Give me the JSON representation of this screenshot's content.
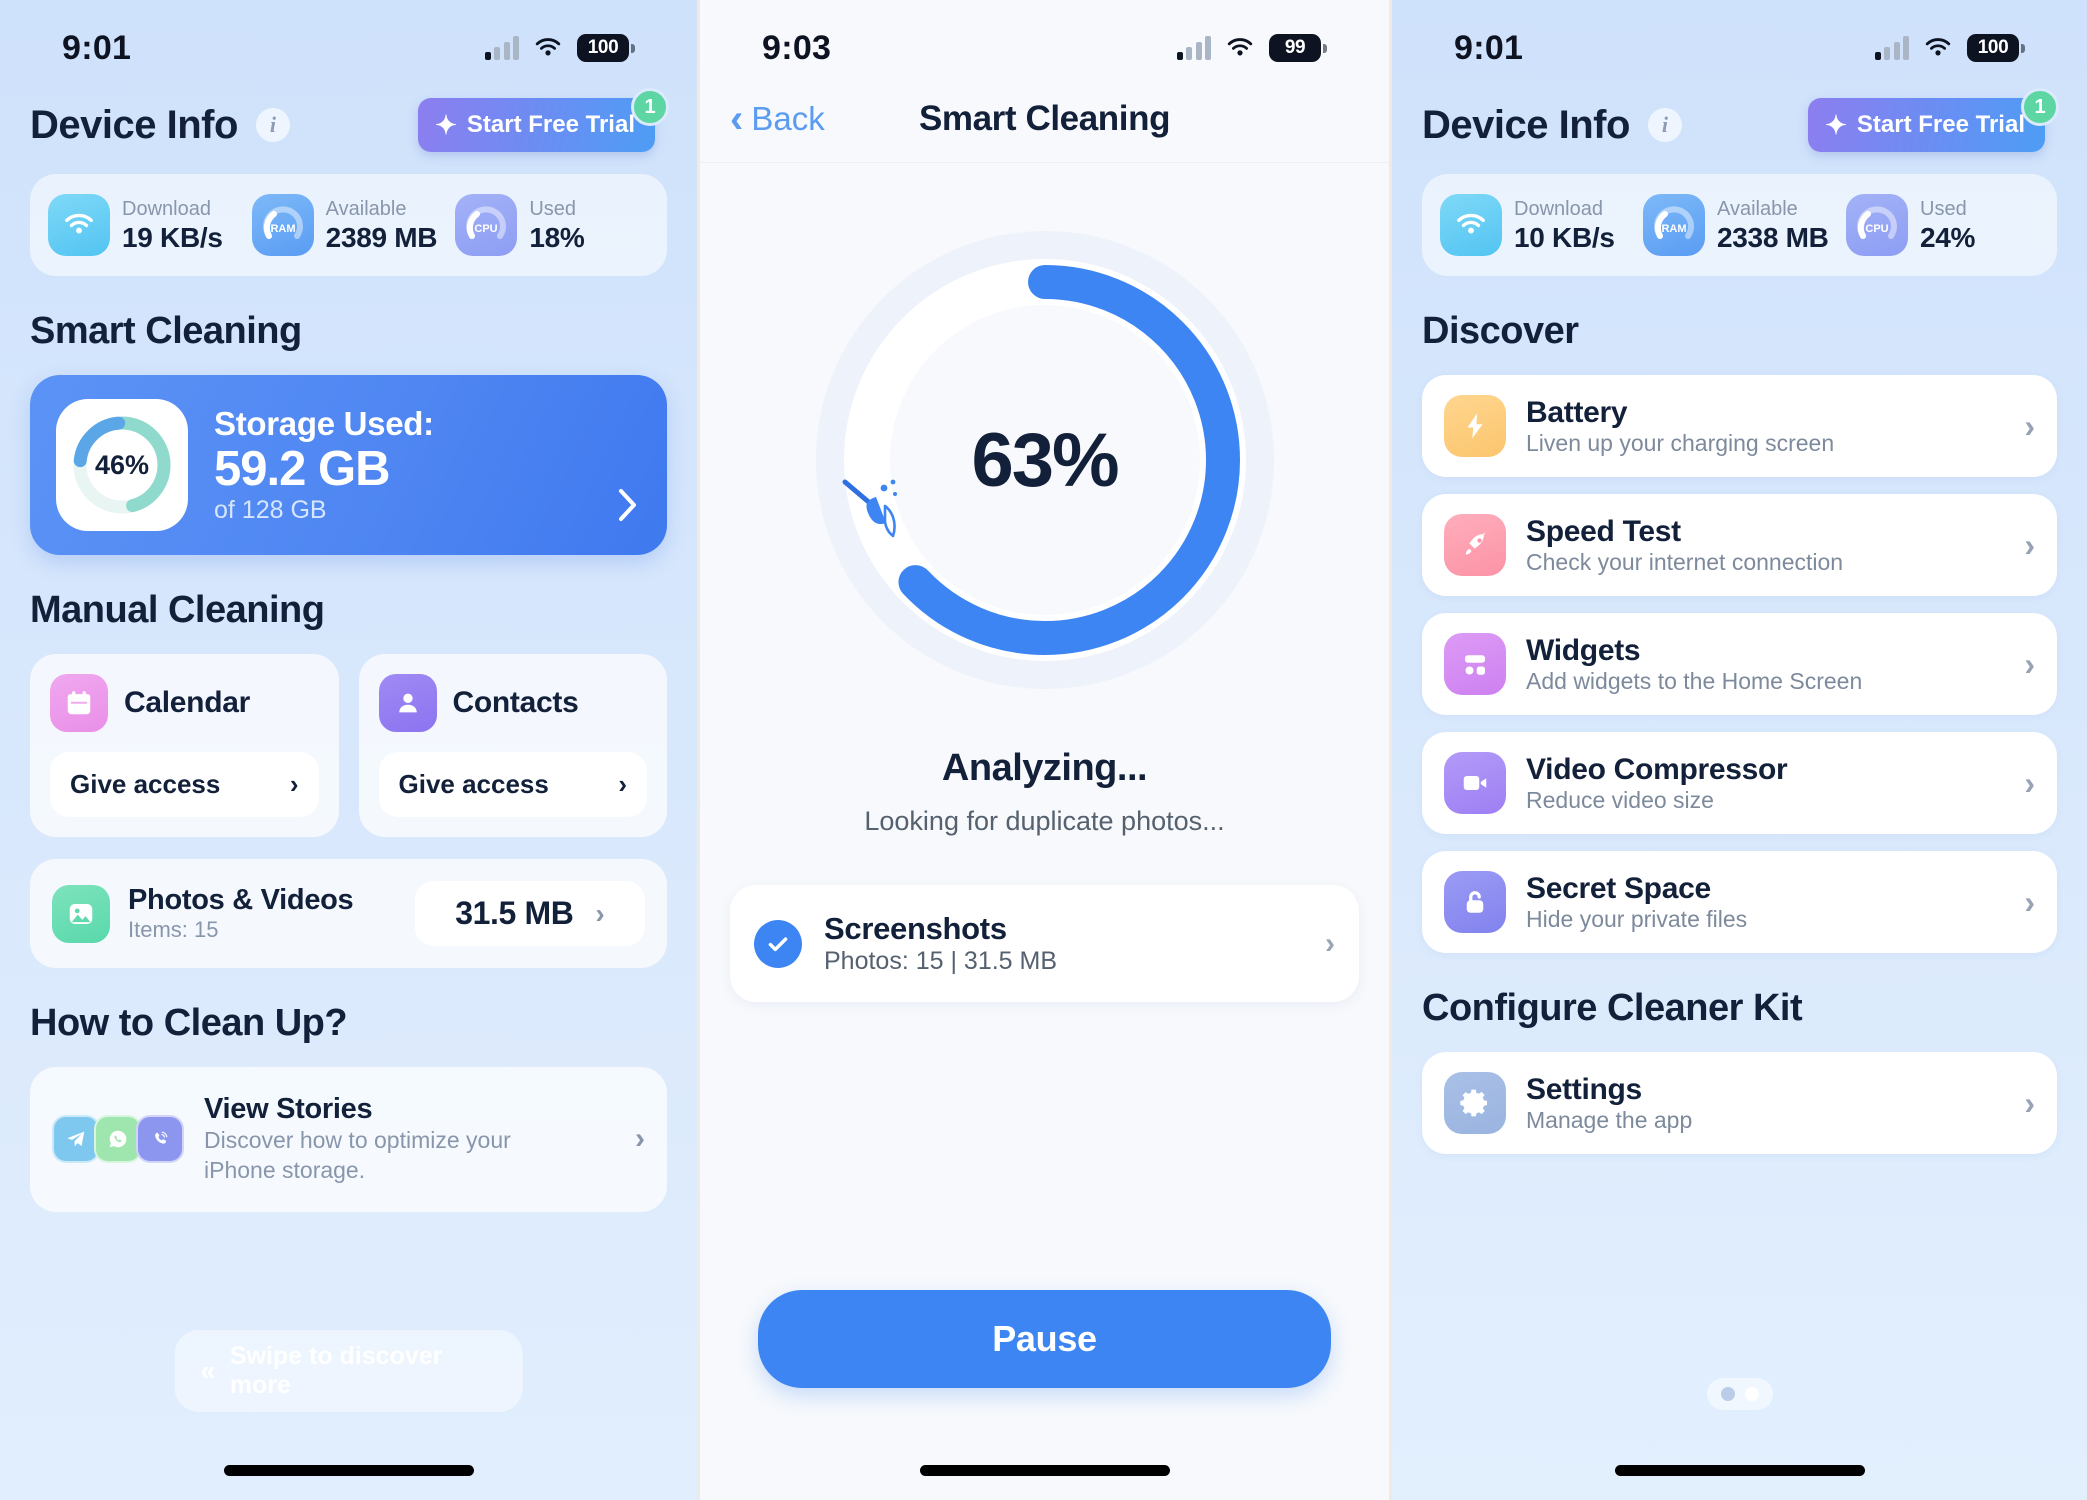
{
  "panel_left": {
    "status": {
      "time": "9:01",
      "battery": "100",
      "signal_icon": "signal-bars-icon",
      "wifi_icon": "wifi-icon"
    },
    "header": {
      "title": "Device Info",
      "info_icon": "info-icon",
      "trial_label": "Start Free Trial",
      "trial_badge": "1",
      "sparkle_icon": "sparkle-icon"
    },
    "stats": [
      {
        "icon": "wifi-icon",
        "label": "Download",
        "value": "19 KB/s"
      },
      {
        "icon": "ram-gauge-icon",
        "gauge": "RAM",
        "label": "Available",
        "value": "2389 MB"
      },
      {
        "icon": "cpu-gauge-icon",
        "gauge": "CPU",
        "label": "Used",
        "value": "18%"
      }
    ],
    "smart_cleaning": {
      "section_title": "Smart Cleaning",
      "ring_percent": "46%",
      "ring_value": 46,
      "storage_label": "Storage Used:",
      "storage_used": "59.2 GB",
      "storage_total": "of 128 GB",
      "chevron_icon": "chevron-right-icon"
    },
    "manual_cleaning": {
      "section_title": "Manual Cleaning",
      "cards": [
        {
          "icon": "calendar-icon",
          "name": "Calendar",
          "action": "Give access",
          "chevron": "chevron-right-icon"
        },
        {
          "icon": "contacts-person-icon",
          "name": "Contacts",
          "action": "Give access",
          "chevron": "chevron-right-icon"
        }
      ],
      "photos": {
        "icon": "photo-icon",
        "title": "Photos & Videos",
        "subtitle": "Items: 15",
        "size": "31.5 MB",
        "chevron": "chevron-right-icon"
      }
    },
    "how_to": {
      "section_title": "How to Clean Up?",
      "icons": [
        "telegram-icon",
        "whatsapp-icon",
        "viber-icon"
      ],
      "title": "View Stories",
      "subtitle": "Discover how to optimize your iPhone storage.",
      "chevron": "chevron-right-icon"
    },
    "swipe": {
      "label": "Swipe to discover more",
      "icon": "double-chevron-left-icon"
    }
  },
  "panel_middle": {
    "status": {
      "time": "9:03",
      "battery": "99",
      "signal_icon": "signal-bars-icon",
      "wifi_icon": "wifi-icon"
    },
    "nav": {
      "back_label": "Back",
      "back_icon": "chevron-left-icon",
      "title": "Smart Cleaning"
    },
    "progress": {
      "percent_label": "63%",
      "percent_value": 63,
      "broom_icon": "broom-icon"
    },
    "status_title": "Analyzing...",
    "status_sub": "Looking for duplicate photos...",
    "result": {
      "check_icon": "check-circle-icon",
      "title": "Screenshots",
      "subtitle": "Photos: 15 | 31.5 MB",
      "chevron": "chevron-right-icon"
    },
    "pause_label": "Pause"
  },
  "panel_right": {
    "status": {
      "time": "9:01",
      "battery": "100",
      "signal_icon": "signal-bars-icon",
      "wifi_icon": "wifi-icon"
    },
    "header": {
      "title": "Device Info",
      "info_icon": "info-icon",
      "trial_label": "Start Free Trial",
      "trial_badge": "1",
      "sparkle_icon": "sparkle-icon"
    },
    "stats": [
      {
        "icon": "wifi-icon",
        "label": "Download",
        "value": "10 KB/s"
      },
      {
        "icon": "ram-gauge-icon",
        "gauge": "RAM",
        "label": "Available",
        "value": "2338 MB"
      },
      {
        "icon": "cpu-gauge-icon",
        "gauge": "CPU",
        "label": "Used",
        "value": "24%"
      }
    ],
    "discover": {
      "section_title": "Discover",
      "items": [
        {
          "icon": "battery-bolt-icon",
          "title": "Battery",
          "subtitle": "Liven up your charging screen",
          "chevron": "chevron-right-icon"
        },
        {
          "icon": "rocket-icon",
          "title": "Speed Test",
          "subtitle": "Check your internet connection",
          "chevron": "chevron-right-icon"
        },
        {
          "icon": "widgets-icon",
          "title": "Widgets",
          "subtitle": "Add widgets to the Home Screen",
          "chevron": "chevron-right-icon"
        },
        {
          "icon": "video-camera-icon",
          "title": "Video Compressor",
          "subtitle": "Reduce video size",
          "chevron": "chevron-right-icon"
        },
        {
          "icon": "lock-icon",
          "title": "Secret Space",
          "subtitle": "Hide your private files",
          "chevron": "chevron-right-icon"
        }
      ]
    },
    "configure": {
      "section_title": "Configure Cleaner Kit",
      "items": [
        {
          "icon": "gear-icon",
          "title": "Settings",
          "subtitle": "Manage the app",
          "chevron": "chevron-right-icon"
        }
      ]
    },
    "page_dots": {
      "count": 2,
      "active_index": 1
    }
  },
  "colors": {
    "accent_blue": "#3d85f2",
    "panel_bg": "#d7e7fc",
    "text_dark": "#13203a",
    "text_muted": "#8896ab",
    "badge_green": "#5ed6a4"
  }
}
